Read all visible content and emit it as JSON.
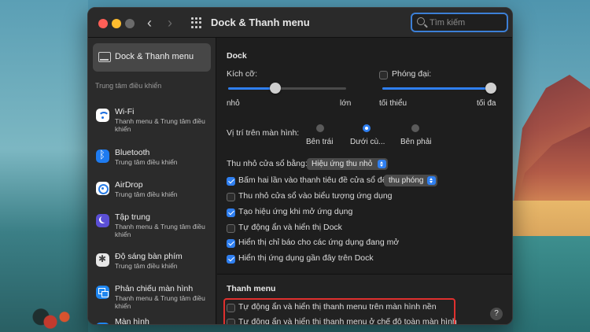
{
  "window": {
    "title": "Dock & Thanh menu"
  },
  "search": {
    "placeholder": "Tìm kiếm",
    "value": ""
  },
  "sidebar": {
    "selected_label": "Dock & Thanh menu",
    "section_label": "Trung tâm điều khiển",
    "items": [
      {
        "name": "Wi-Fi",
        "sub": "Thanh menu & Trung tâm điều khiển",
        "icon": "wifi-icon"
      },
      {
        "name": "Bluetooth",
        "sub": "Trung tâm điều khiển",
        "icon": "bluetooth-icon"
      },
      {
        "name": "AirDrop",
        "sub": "Trung tâm điều khiển",
        "icon": "airdrop-icon"
      },
      {
        "name": "Tập trung",
        "sub": "Thanh menu & Trung tâm điều khiển",
        "icon": "focus-moon-icon"
      },
      {
        "name": "Độ sáng bàn phím",
        "sub": "Trung tâm điều khiển",
        "icon": "keyboard-brightness-icon"
      },
      {
        "name": "Phản chiếu màn hình",
        "sub": "Thanh menu & Trung tâm điều khiển",
        "icon": "screen-mirroring-icon"
      },
      {
        "name": "Màn hình",
        "sub": "",
        "icon": "display-icon"
      }
    ]
  },
  "dock": {
    "section_title": "Dock",
    "size": {
      "label": "Kích cỡ:",
      "min": "nhỏ",
      "max": "lớn",
      "value": 0.4
    },
    "magnification": {
      "label": "Phóng đại:",
      "checked": false,
      "min": "tối thiểu",
      "max": "tối đa",
      "value": 1.0
    },
    "position": {
      "label": "Vị trí trên màn hình:",
      "options": [
        {
          "label": "Bên trái",
          "selected": false
        },
        {
          "label": "Dưới cù...",
          "selected": true
        },
        {
          "label": "Bên phải",
          "selected": false
        }
      ]
    },
    "minimize_using": {
      "label": "Thu nhỏ cửa sổ bằng:",
      "value": "Hiệu ứng thu nhỏ"
    },
    "double_click": {
      "label": "Bấm hai lần vào thanh tiêu đề cửa sổ để",
      "checked": true,
      "value": "thu phóng"
    },
    "options": [
      {
        "label": "Thu nhỏ cửa sổ vào biểu tượng ứng dụng",
        "checked": false
      },
      {
        "label": "Tạo hiệu ứng khi mở ứng dụng",
        "checked": true
      },
      {
        "label": "Tự động ẩn và hiển thị Dock",
        "checked": false
      },
      {
        "label": "Hiển thị chỉ báo cho các ứng dụng đang mở",
        "checked": true
      },
      {
        "label": "Hiển thị ứng dụng gần đây trên Dock",
        "checked": true
      }
    ]
  },
  "menubar": {
    "section_title": "Thanh menu",
    "options": [
      {
        "label": "Tự động ẩn và hiển thị thanh menu trên màn hình nền",
        "checked": false
      },
      {
        "label": "Tự động ẩn và hiển thị thanh menu ở chế độ toàn màn hình",
        "checked": false
      }
    ]
  },
  "help": {
    "label": "?"
  },
  "colors": {
    "accent": "#2f7ff0",
    "highlight": "#e0302e",
    "window_bg": "#1e1e1e",
    "sidebar_bg": "#2b2b2b"
  }
}
